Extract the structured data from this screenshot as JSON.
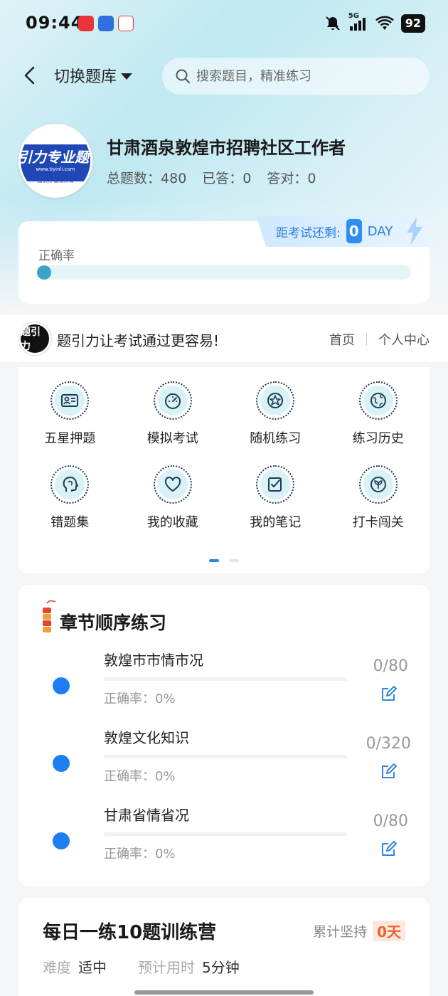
{
  "status_bar": {
    "time": "09:44",
    "network": "5G",
    "battery": "92"
  },
  "header": {
    "switch_label": "切换题库",
    "search_placeholder": "搜索题目，精准练习"
  },
  "profile": {
    "avatar_title": "引力专业题",
    "avatar_url": "www.tiyinli.com",
    "avatar_footer": "题引力 版权所有",
    "bank_title": "甘肃酒泉敦煌市招聘社区工作者",
    "stats": {
      "total_label": "总题数：",
      "total": "480",
      "answered_label": "已答：",
      "answered": "0",
      "correct_label": "答对：",
      "correct": "0"
    }
  },
  "accuracy": {
    "label": "正确率",
    "value": 0,
    "countdown_label": "距考试还剩:",
    "countdown_value": "0",
    "countdown_unit": "DAY"
  },
  "brand": {
    "logo_text": "题引力",
    "slogan": "题引力让考试通过更容易!",
    "nav": [
      "首页",
      "个人中心"
    ]
  },
  "functions": [
    {
      "label": "五星押题",
      "icon": "id-card-icon"
    },
    {
      "label": "模拟考试",
      "icon": "speedometer-icon"
    },
    {
      "label": "随机练习",
      "icon": "shuffle-star-icon"
    },
    {
      "label": "练习历史",
      "icon": "globe-history-icon"
    },
    {
      "label": "错题集",
      "icon": "head-brain-icon"
    },
    {
      "label": "我的收藏",
      "icon": "heart-icon"
    },
    {
      "label": "我的笔记",
      "icon": "note-check-icon"
    },
    {
      "label": "打卡闯关",
      "icon": "sprout-icon"
    }
  ],
  "pager": {
    "pages": 2,
    "active": 0
  },
  "chapters": {
    "title": "章节顺序练习",
    "items": [
      {
        "name": "敦煌市市情市况",
        "accuracy": "正确率：0%",
        "count": "0/80"
      },
      {
        "name": "敦煌文化知识",
        "accuracy": "正确率：0%",
        "count": "0/320"
      },
      {
        "name": "甘肃省情省况",
        "accuracy": "正确率：0%",
        "count": "0/80"
      }
    ]
  },
  "daily": {
    "title": "每日一练10题训练营",
    "streak_label": "累计坚持",
    "streak_value": "0天",
    "difficulty_label": "难度",
    "difficulty_value": "适中",
    "time_label": "预计用时",
    "time_value": "5分钟"
  }
}
